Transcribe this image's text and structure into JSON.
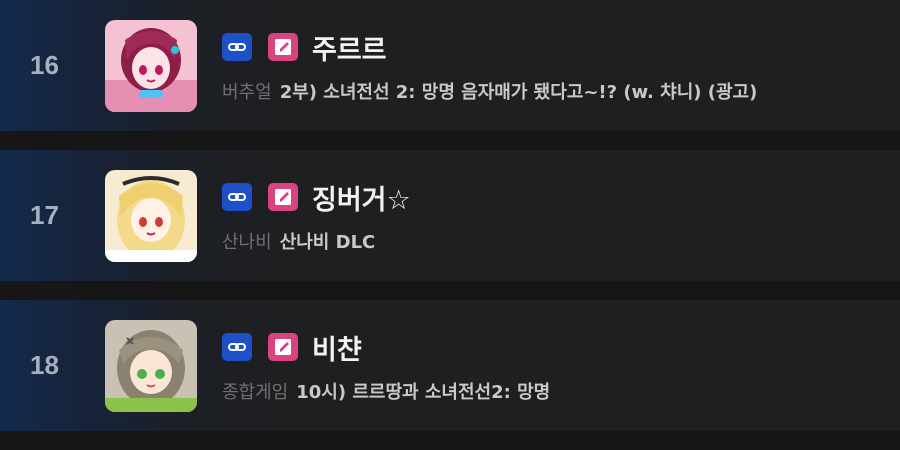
{
  "rankings": [
    {
      "rank": "16",
      "name": "주르르",
      "category": "버추얼",
      "title": "2부) 소녀전선 2: 망명 음자매가 됐다고~!? (w. 챠니) (광고)",
      "avatar_icon": "streamer-avatar-juru",
      "platform_icon": "chain-link-icon",
      "edit_icon": "pencil-icon"
    },
    {
      "rank": "17",
      "name": "징버거☆",
      "category": "산나비",
      "title": "산나비 DLC",
      "avatar_icon": "streamer-avatar-jingburger",
      "platform_icon": "chain-link-icon",
      "edit_icon": "pencil-icon"
    },
    {
      "rank": "18",
      "name": "비챤",
      "category": "종합게임",
      "title": "10시) 르르땅과 소녀전선2: 망명",
      "avatar_icon": "streamer-avatar-viichan",
      "platform_icon": "chain-link-icon",
      "edit_icon": "pencil-icon"
    }
  ],
  "colors": {
    "background": "#161616",
    "row_background": "#1f1f1f",
    "platform_badge": "#1f4fc9",
    "edit_badge": "#d94383",
    "rank_text": "#a8b0bd",
    "name_text": "#f2f2f2",
    "category_text": "#707070",
    "title_text": "#c9c9c9"
  }
}
